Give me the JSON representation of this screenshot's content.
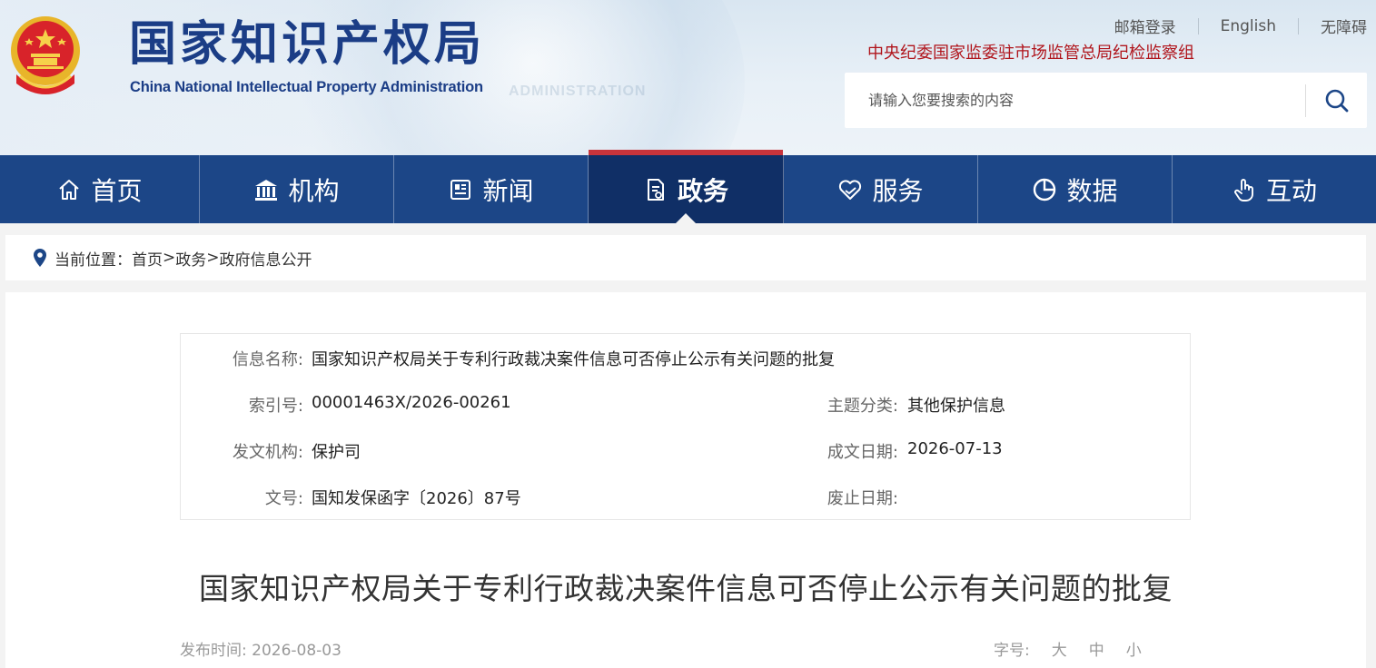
{
  "header": {
    "logo_cn": "国家知识产权局",
    "logo_en": "China National Intellectual Property Administration",
    "watermark": "ADMINISTRATION",
    "links": [
      "邮箱登录",
      "English",
      "无障碍"
    ],
    "discipline": "中央纪委国家监委驻市场监管总局纪检监察组",
    "search_placeholder": "请输入您要搜索的内容"
  },
  "nav": {
    "items": [
      {
        "label": "首页",
        "icon": "home-icon"
      },
      {
        "label": "机构",
        "icon": "institution-icon"
      },
      {
        "label": "新闻",
        "icon": "newspaper-icon"
      },
      {
        "label": "政务",
        "icon": "document-icon"
      },
      {
        "label": "服务",
        "icon": "heart-hand-icon"
      },
      {
        "label": "数据",
        "icon": "pie-chart-icon"
      },
      {
        "label": "互动",
        "icon": "hand-pointer-icon"
      }
    ],
    "active": "政务"
  },
  "breadcrumb": {
    "prefix": "当前位置：",
    "items": [
      "首页",
      "政务",
      "政府信息公开"
    ],
    "separator": ">"
  },
  "meta": {
    "name_label": "信息名称:",
    "name_value": "国家知识产权局关于专利行政裁决案件信息可否停止公示有关问题的批复",
    "index_label": "索引号:",
    "index_value": "00001463X/2026-00261",
    "topic_label": "主题分类:",
    "topic_value": "其他保护信息",
    "issuer_label": "发文机构:",
    "issuer_value": "保护司",
    "date_label": "成文日期:",
    "date_value": "2026-07-13",
    "docno_label": "文号:",
    "docno_value": "国知发保函字〔2026〕87号",
    "expiry_label": "废止日期:",
    "expiry_value": ""
  },
  "article": {
    "title": "国家知识产权局关于专利行政裁决案件信息可否停止公示有关问题的批复",
    "publish_label": "发布时间:",
    "publish_date": "2026-08-03",
    "fontsize_label": "字号:",
    "fontsize_options": [
      "大",
      "中",
      "小"
    ]
  },
  "colors": {
    "nav_bg": "#1c4687",
    "nav_active_bg": "#102f66",
    "accent_red": "#c8343b",
    "brand_blue": "#1b3d86"
  }
}
